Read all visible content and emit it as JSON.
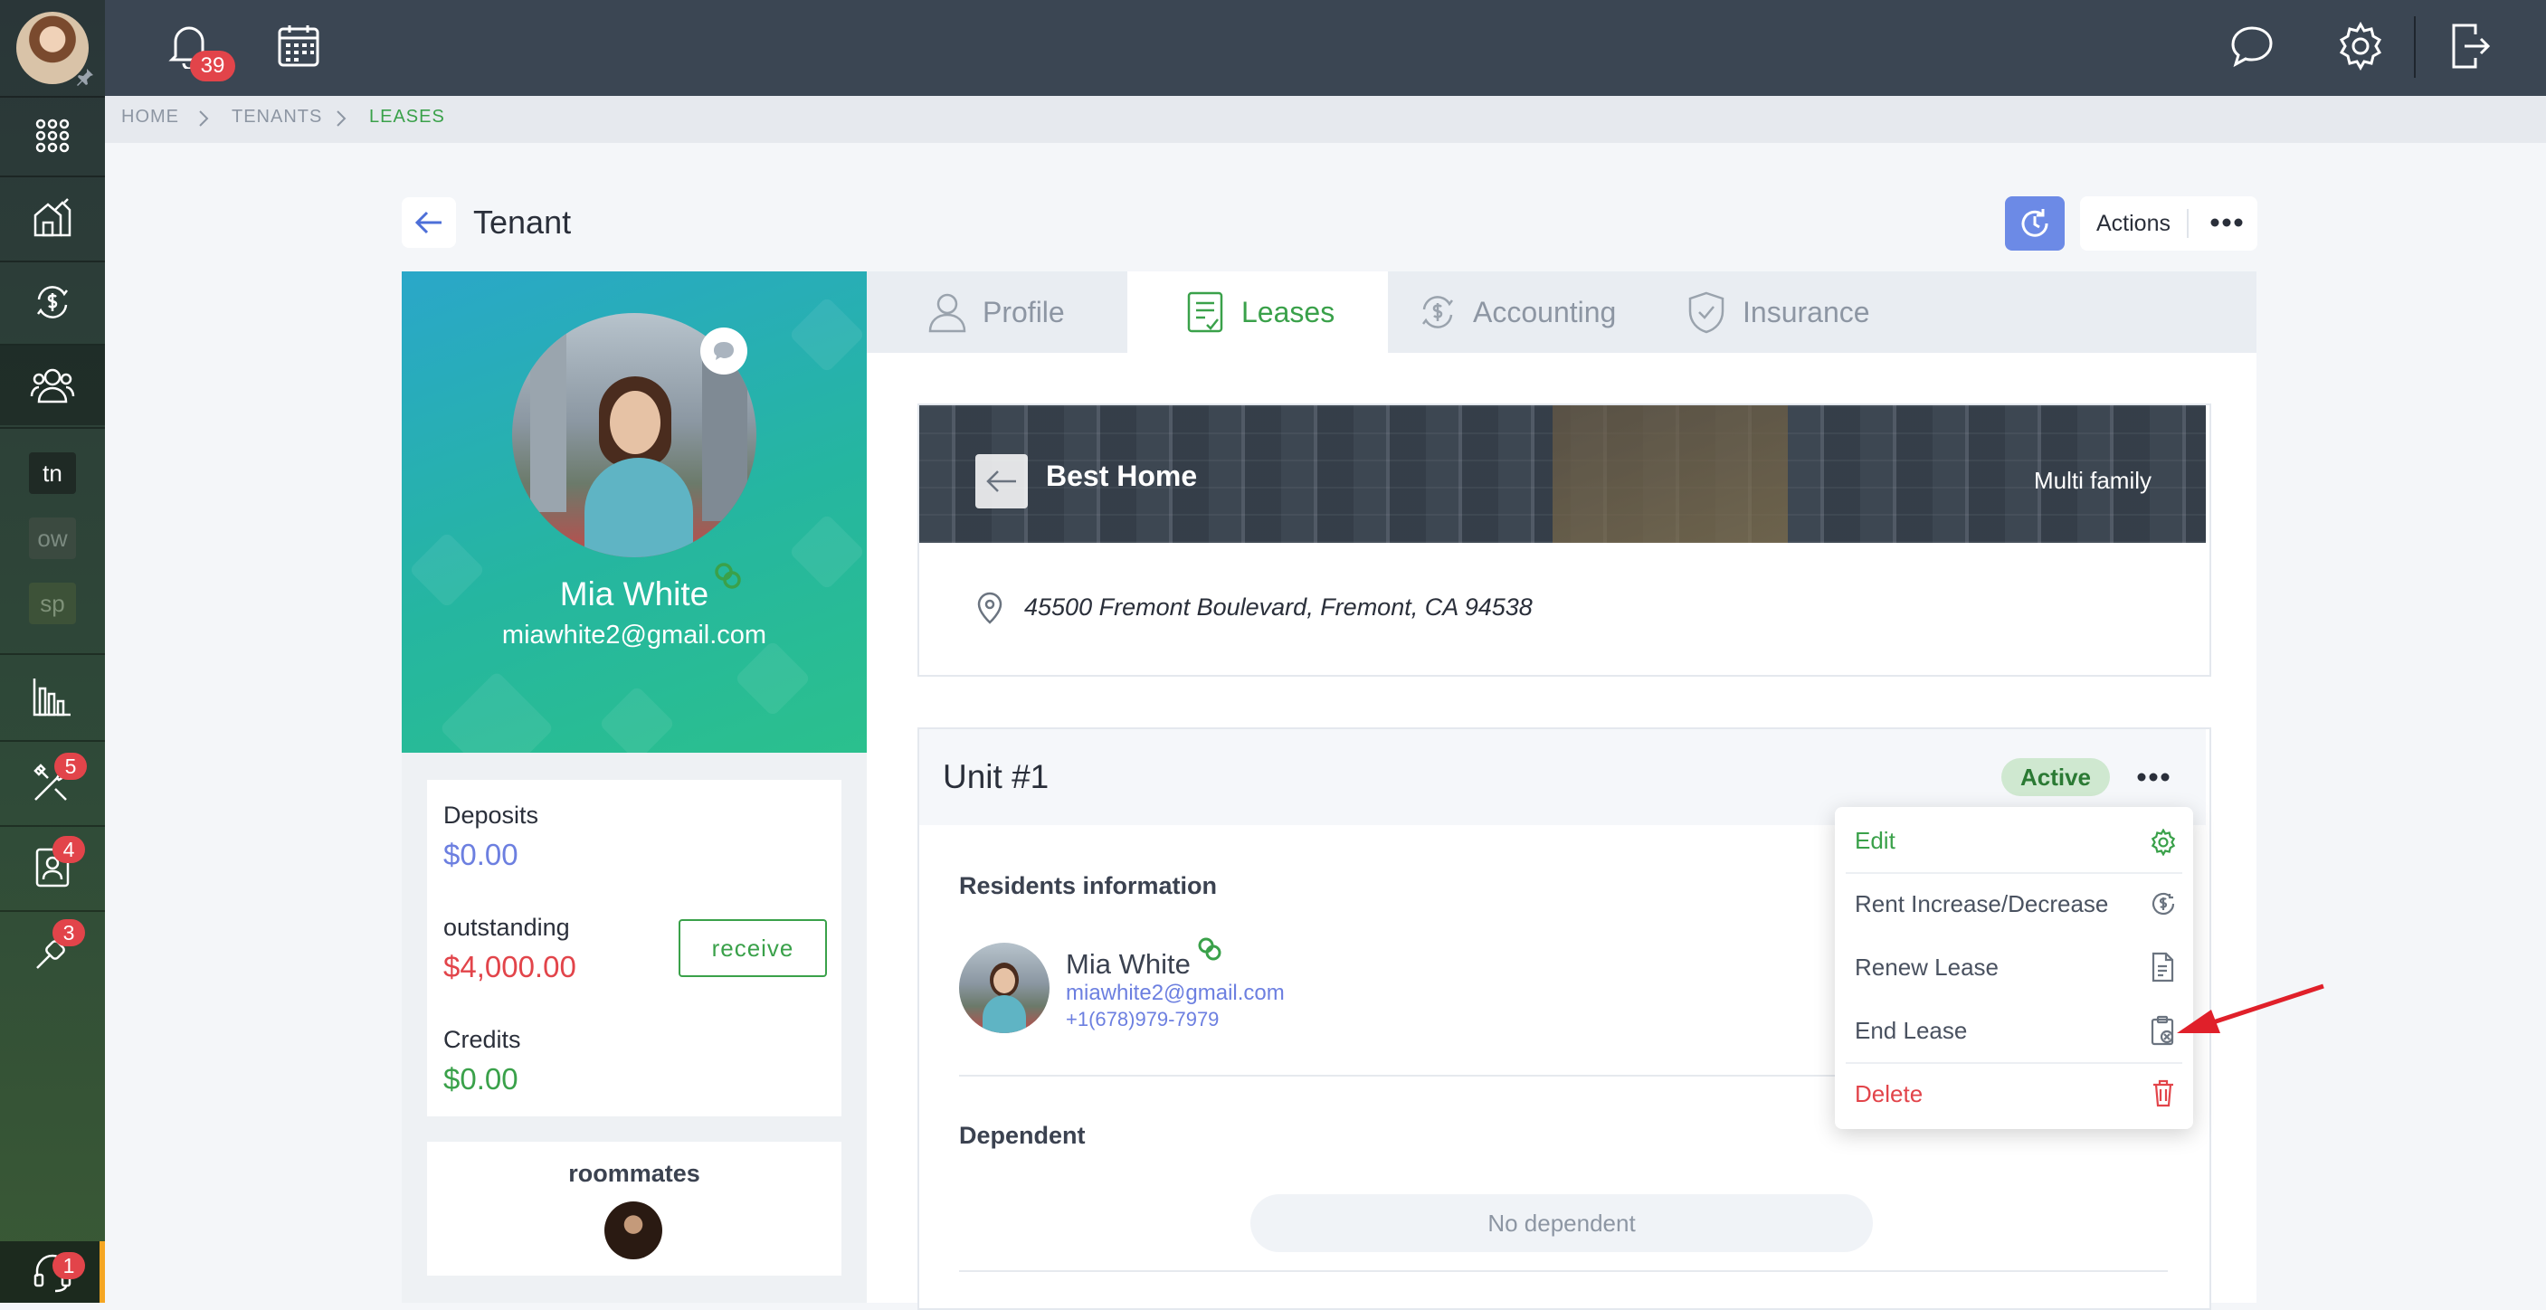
{
  "sidebar": {
    "text_items": [
      {
        "label": "tn"
      },
      {
        "label": "ow"
      },
      {
        "label": "sp"
      }
    ],
    "badges": {
      "maintenance": "5",
      "contacts": "4",
      "tools": "3",
      "support": "1"
    }
  },
  "topbar": {
    "notifications_count": "39"
  },
  "breadcrumb": [
    "HOME",
    "TENANTS",
    "LEASES"
  ],
  "page": {
    "title": "Tenant",
    "actions_label": "Actions"
  },
  "tenant": {
    "name": "Mia White",
    "email": "miawhite2@gmail.com",
    "deposits_label": "Deposits",
    "deposits_value": "$0.00",
    "outstanding_label": "outstanding",
    "outstanding_value": "$4,000.00",
    "receive_label": "receive",
    "credits_label": "Credits",
    "credits_value": "$0.00",
    "roommates_label": "roommates"
  },
  "tabs": [
    {
      "label": "Profile"
    },
    {
      "label": "Leases"
    },
    {
      "label": "Accounting"
    },
    {
      "label": "Insurance"
    }
  ],
  "property": {
    "name": "Best Home",
    "type": "Multi family",
    "address": "45500 Fremont Boulevard, Fremont, CA 94538"
  },
  "unit": {
    "title": "Unit #1",
    "status": "Active",
    "residents_heading": "Residents information",
    "resident": {
      "name": "Mia White",
      "email": "miawhite2@gmail.com",
      "phone": "+1(678)979-7979"
    },
    "dependent_heading": "Dependent",
    "no_dependent": "No dependent"
  },
  "menu": {
    "items": [
      {
        "label": "Edit",
        "icon": "gear-icon",
        "color": "#3aa14a"
      },
      {
        "label": "Rent Increase/Decrease",
        "icon": "dollar-clock-icon",
        "color": "#4a5260"
      },
      {
        "label": "Renew Lease",
        "icon": "document-icon",
        "color": "#4a5260"
      },
      {
        "label": "End Lease",
        "icon": "clipboard-x-icon",
        "color": "#4a5260"
      },
      {
        "label": "Delete",
        "icon": "trash-icon",
        "color": "#e2444a"
      }
    ]
  },
  "colors": {
    "accent_green": "#3aa14a",
    "danger_red": "#e2444a",
    "link_blue": "#6c7fe0",
    "topbar": "#3b4653"
  }
}
